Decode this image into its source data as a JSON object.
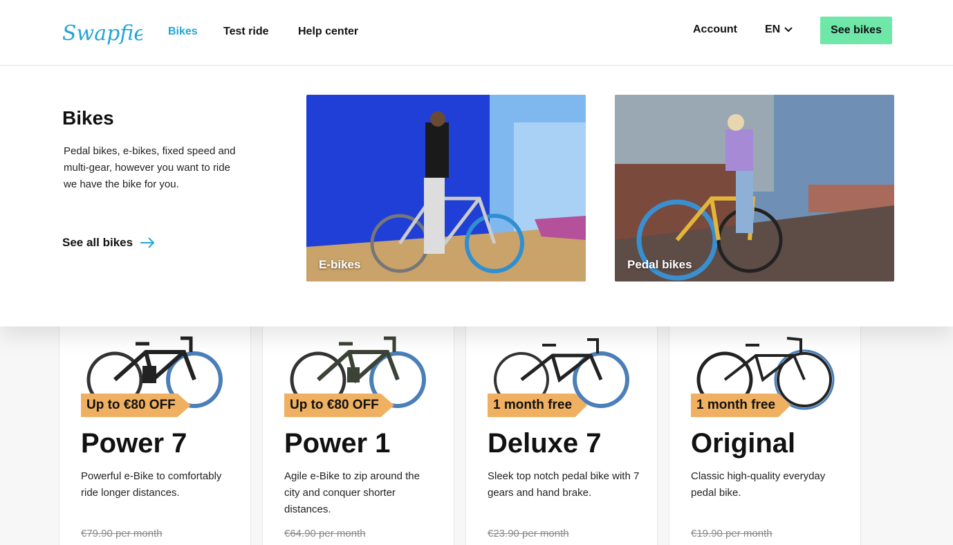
{
  "header": {
    "logo_text": "Swapfiets",
    "nav": [
      {
        "label": "Bikes",
        "active": true
      },
      {
        "label": "Test ride"
      },
      {
        "label": "Help center"
      }
    ],
    "account_label": "Account",
    "language": "EN",
    "cta_label": "See bikes"
  },
  "mega_menu": {
    "title": "Bikes",
    "description": "Pedal bikes, e-bikes, fixed speed and multi-gear, however you want to ride we have the bike for you.",
    "see_all_label": "See all bikes",
    "tiles": [
      {
        "label": "E-bikes"
      },
      {
        "label": "Pedal bikes"
      }
    ]
  },
  "products": [
    {
      "badge": "Up to €80 OFF",
      "name": "Power 7",
      "description": "Powerful e-Bike to comfortably ride longer distances.",
      "old_price": "€79.90 per month"
    },
    {
      "badge": "Up to €80 OFF",
      "name": "Power 1",
      "description": "Agile e-Bike to zip around the city and conquer shorter distances.",
      "old_price": "€64.90 per month"
    },
    {
      "badge": "1 month free",
      "name": "Deluxe 7",
      "description": "Sleek top notch pedal bike with 7 gears and hand brake.",
      "old_price": "€23.90 per month"
    },
    {
      "badge": "1 month free",
      "name": "Original",
      "description": "Classic high-quality everyday pedal bike.",
      "old_price": "€19.90 per month"
    }
  ],
  "colors": {
    "accent": "#22a5d4",
    "cta": "#6ee7a9",
    "badge": "#f0b062"
  }
}
